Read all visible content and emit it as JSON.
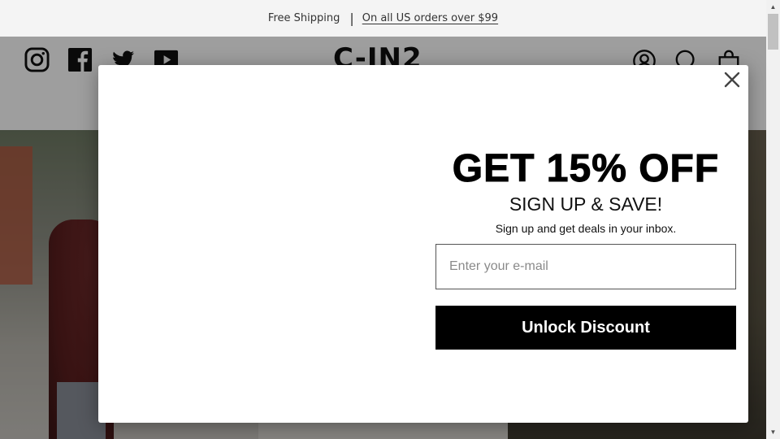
{
  "announcement": {
    "text": "Free Shipping",
    "separator": "|",
    "link_text": "On all US orders over $99"
  },
  "header": {
    "logo_text": "C-IN2",
    "social_icons": [
      "instagram-icon",
      "facebook-icon",
      "twitter-icon",
      "youtube-icon"
    ],
    "right_icons": [
      "account-icon",
      "search-icon",
      "bag-icon"
    ]
  },
  "modal": {
    "headline": "GET 15% OFF",
    "subheadline": "SIGN UP & SAVE!",
    "description": "Sign up and get deals in your inbox.",
    "email_placeholder": "Enter your e-mail",
    "email_value": "",
    "cta_label": "Unlock Discount",
    "close_icon": "close-icon"
  },
  "colors": {
    "announcement_bg": "#f4f4f4",
    "cta_bg": "#000000",
    "cta_text": "#ffffff",
    "overlay": "rgba(0,0,0,0.38)"
  }
}
